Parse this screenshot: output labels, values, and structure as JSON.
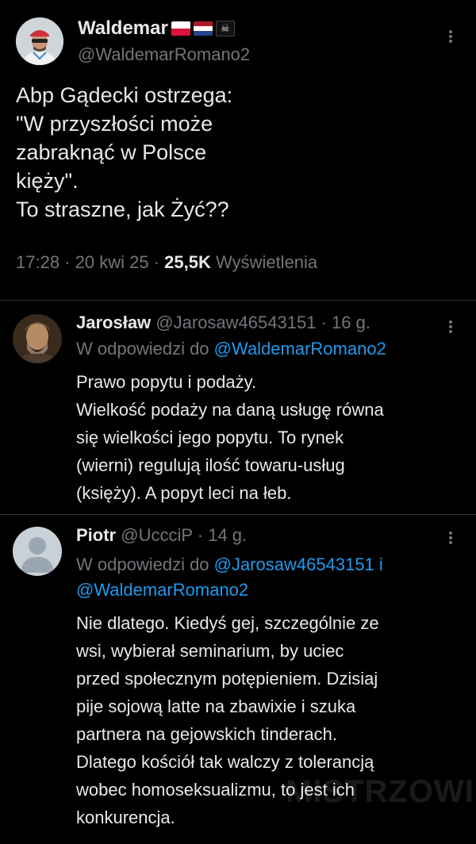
{
  "main": {
    "name": "Waldemar",
    "flags": [
      "poland-flag",
      "netherlands-flag",
      "pirate-flag"
    ],
    "pirate_glyph": "☠",
    "handle": "@WaldemarRomano2",
    "text": "Abp Gądecki ostrzega:\n\"W przyszłości może\nzabraknąć w Polsce\nkięży\".\nTo straszne, jak Żyć??",
    "time": "17:28",
    "date": "20 kwi 25",
    "views_count": "25,5K",
    "views_label": "Wyświetlenia",
    "separator": " · "
  },
  "replies": [
    {
      "name": "Jarosław",
      "handle": "@Jarosaw46543151",
      "age": "16 g.",
      "reply_to_prefix": "W odpowiedzi do ",
      "mentions": [
        "@WaldemarRomano2"
      ],
      "text": "Prawo popytu i podaży.\nWielkość podaży na daną usługę równa\nsię wielkości jego popytu. To rynek\n(wierni) regulują ilość towaru-usług\n(księży). A popyt leci na łeb."
    },
    {
      "name": "Piotr",
      "handle": "@UccciP",
      "age": "14 g.",
      "reply_to_prefix": "W odpowiedzi do ",
      "mentions": [
        "@Jarosaw46543151",
        "@WaldemarRomano2"
      ],
      "mention_joiner": " i",
      "text": "Nie dlatego.  Kiedyś gej, szczególnie ze\nwsi, wybierał seminarium, by uciec\nprzed społecznym potępieniem. Dzisiaj\npije sojową latte na zbawixie i szuka\npartnera na gejowskich tinderach.\nDlatego kościół tak walczy z tolerancją\nwobec homoseksualizmu, to jest ich\nkonkurencja."
    }
  ],
  "watermark": "MISTRZOWIE",
  "colors": {
    "background": "#000000",
    "text": "#e7e9ea",
    "muted": "#71767b",
    "link": "#1d9bf0",
    "divider": "#2f3336"
  }
}
